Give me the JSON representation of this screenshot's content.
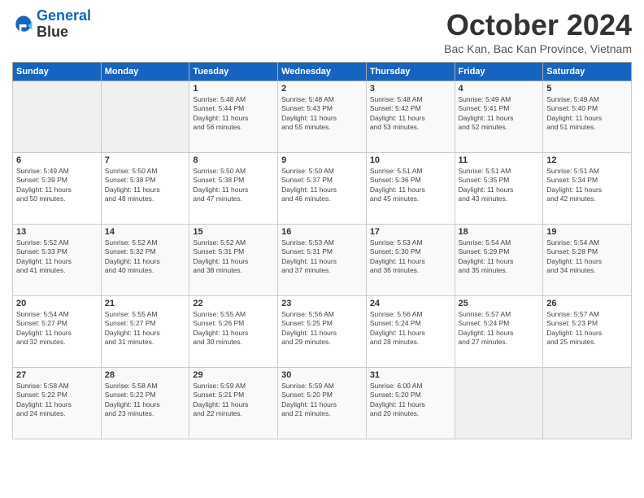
{
  "logo": {
    "line1": "General",
    "line2": "Blue"
  },
  "title": "October 2024",
  "subtitle": "Bac Kan, Bac Kan Province, Vietnam",
  "days_of_week": [
    "Sunday",
    "Monday",
    "Tuesday",
    "Wednesday",
    "Thursday",
    "Friday",
    "Saturday"
  ],
  "weeks": [
    [
      {
        "day": "",
        "info": ""
      },
      {
        "day": "",
        "info": ""
      },
      {
        "day": "1",
        "info": "Sunrise: 5:48 AM\nSunset: 5:44 PM\nDaylight: 11 hours\nand 56 minutes."
      },
      {
        "day": "2",
        "info": "Sunrise: 5:48 AM\nSunset: 5:43 PM\nDaylight: 11 hours\nand 55 minutes."
      },
      {
        "day": "3",
        "info": "Sunrise: 5:48 AM\nSunset: 5:42 PM\nDaylight: 11 hours\nand 53 minutes."
      },
      {
        "day": "4",
        "info": "Sunrise: 5:49 AM\nSunset: 5:41 PM\nDaylight: 11 hours\nand 52 minutes."
      },
      {
        "day": "5",
        "info": "Sunrise: 5:49 AM\nSunset: 5:40 PM\nDaylight: 11 hours\nand 51 minutes."
      }
    ],
    [
      {
        "day": "6",
        "info": "Sunrise: 5:49 AM\nSunset: 5:39 PM\nDaylight: 11 hours\nand 50 minutes."
      },
      {
        "day": "7",
        "info": "Sunrise: 5:50 AM\nSunset: 5:38 PM\nDaylight: 11 hours\nand 48 minutes."
      },
      {
        "day": "8",
        "info": "Sunrise: 5:50 AM\nSunset: 5:38 PM\nDaylight: 11 hours\nand 47 minutes."
      },
      {
        "day": "9",
        "info": "Sunrise: 5:50 AM\nSunset: 5:37 PM\nDaylight: 11 hours\nand 46 minutes."
      },
      {
        "day": "10",
        "info": "Sunrise: 5:51 AM\nSunset: 5:36 PM\nDaylight: 11 hours\nand 45 minutes."
      },
      {
        "day": "11",
        "info": "Sunrise: 5:51 AM\nSunset: 5:35 PM\nDaylight: 11 hours\nand 43 minutes."
      },
      {
        "day": "12",
        "info": "Sunrise: 5:51 AM\nSunset: 5:34 PM\nDaylight: 11 hours\nand 42 minutes."
      }
    ],
    [
      {
        "day": "13",
        "info": "Sunrise: 5:52 AM\nSunset: 5:33 PM\nDaylight: 11 hours\nand 41 minutes."
      },
      {
        "day": "14",
        "info": "Sunrise: 5:52 AM\nSunset: 5:32 PM\nDaylight: 11 hours\nand 40 minutes."
      },
      {
        "day": "15",
        "info": "Sunrise: 5:52 AM\nSunset: 5:31 PM\nDaylight: 11 hours\nand 38 minutes."
      },
      {
        "day": "16",
        "info": "Sunrise: 5:53 AM\nSunset: 5:31 PM\nDaylight: 11 hours\nand 37 minutes."
      },
      {
        "day": "17",
        "info": "Sunrise: 5:53 AM\nSunset: 5:30 PM\nDaylight: 11 hours\nand 36 minutes."
      },
      {
        "day": "18",
        "info": "Sunrise: 5:54 AM\nSunset: 5:29 PM\nDaylight: 11 hours\nand 35 minutes."
      },
      {
        "day": "19",
        "info": "Sunrise: 5:54 AM\nSunset: 5:28 PM\nDaylight: 11 hours\nand 34 minutes."
      }
    ],
    [
      {
        "day": "20",
        "info": "Sunrise: 5:54 AM\nSunset: 5:27 PM\nDaylight: 11 hours\nand 32 minutes."
      },
      {
        "day": "21",
        "info": "Sunrise: 5:55 AM\nSunset: 5:27 PM\nDaylight: 11 hours\nand 31 minutes."
      },
      {
        "day": "22",
        "info": "Sunrise: 5:55 AM\nSunset: 5:26 PM\nDaylight: 11 hours\nand 30 minutes."
      },
      {
        "day": "23",
        "info": "Sunrise: 5:56 AM\nSunset: 5:25 PM\nDaylight: 11 hours\nand 29 minutes."
      },
      {
        "day": "24",
        "info": "Sunrise: 5:56 AM\nSunset: 5:24 PM\nDaylight: 11 hours\nand 28 minutes."
      },
      {
        "day": "25",
        "info": "Sunrise: 5:57 AM\nSunset: 5:24 PM\nDaylight: 11 hours\nand 27 minutes."
      },
      {
        "day": "26",
        "info": "Sunrise: 5:57 AM\nSunset: 5:23 PM\nDaylight: 11 hours\nand 25 minutes."
      }
    ],
    [
      {
        "day": "27",
        "info": "Sunrise: 5:58 AM\nSunset: 5:22 PM\nDaylight: 11 hours\nand 24 minutes."
      },
      {
        "day": "28",
        "info": "Sunrise: 5:58 AM\nSunset: 5:22 PM\nDaylight: 11 hours\nand 23 minutes."
      },
      {
        "day": "29",
        "info": "Sunrise: 5:59 AM\nSunset: 5:21 PM\nDaylight: 11 hours\nand 22 minutes."
      },
      {
        "day": "30",
        "info": "Sunrise: 5:59 AM\nSunset: 5:20 PM\nDaylight: 11 hours\nand 21 minutes."
      },
      {
        "day": "31",
        "info": "Sunrise: 6:00 AM\nSunset: 5:20 PM\nDaylight: 11 hours\nand 20 minutes."
      },
      {
        "day": "",
        "info": ""
      },
      {
        "day": "",
        "info": ""
      }
    ]
  ]
}
